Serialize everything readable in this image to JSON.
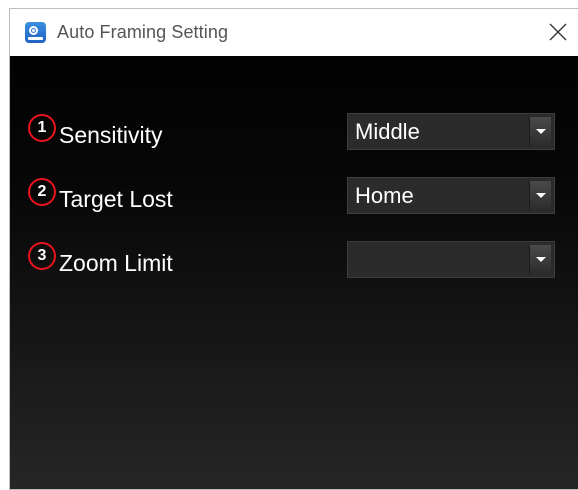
{
  "window": {
    "title": "Auto Framing Setting"
  },
  "settings": [
    {
      "number": "1",
      "label": "Sensitivity",
      "value": "Middle"
    },
    {
      "number": "2",
      "label": "Target Lost",
      "value": "Home"
    },
    {
      "number": "3",
      "label": "Zoom Limit",
      "value": ""
    }
  ],
  "colors": {
    "badge_ring": "#e8141d",
    "background": "#000000",
    "dropdown": "#2b2b2b",
    "app_icon": "#2a78d6"
  },
  "icons": {
    "app": "camera-app-icon",
    "close": "close-icon",
    "dropdown": "chevron-down-icon"
  }
}
